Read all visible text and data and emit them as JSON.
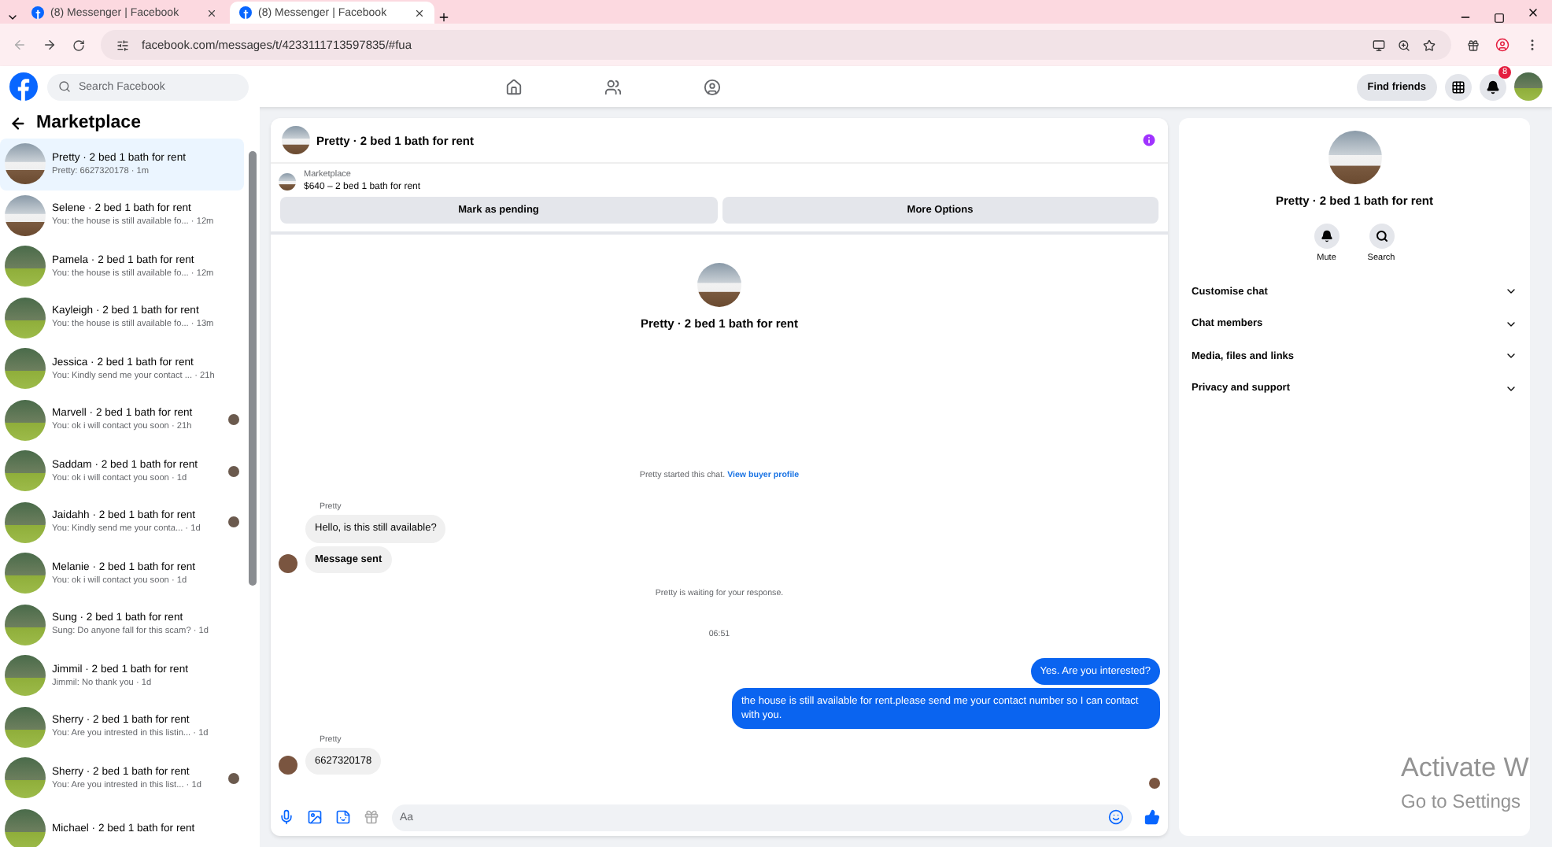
{
  "browser": {
    "tabs": [
      {
        "title": "(8) Messenger | Facebook",
        "selected": false
      },
      {
        "title": "(8) Messenger | Facebook",
        "selected": true
      }
    ],
    "url": "facebook.com/messages/t/4233111713597835/#fua"
  },
  "header": {
    "search_placeholder": "Search Facebook",
    "find_friends": "Find friends",
    "notifications_badge": "8"
  },
  "sidebar": {
    "title": "Marketplace",
    "conversations": [
      {
        "name": "Pretty · 2 bed 1 bath for rent",
        "preview": "Pretty: 6627320178 · 1m",
        "selected": true,
        "seen": false
      },
      {
        "name": "Selene · 2 bed 1 bath for rent",
        "preview": "You: the house is still available fo... · 12m",
        "selected": false,
        "seen": false
      },
      {
        "name": "Pamela · 2 bed 1 bath for rent",
        "preview": "You: the house is still available fo... · 12m",
        "selected": false,
        "seen": false
      },
      {
        "name": "Kayleigh · 2 bed 1 bath for rent",
        "preview": "You: the house is still available fo... · 13m",
        "selected": false,
        "seen": false
      },
      {
        "name": "Jessica · 2 bed 1 bath for rent",
        "preview": "You: Kindly send me your contact ... · 21h",
        "selected": false,
        "seen": false
      },
      {
        "name": "Marvell · 2 bed 1 bath for rent",
        "preview": "You: ok i will contact you soon · 21h",
        "selected": false,
        "seen": true
      },
      {
        "name": "Saddam · 2 bed 1 bath for rent",
        "preview": "You: ok i will contact you soon · 1d",
        "selected": false,
        "seen": true
      },
      {
        "name": "Jaidahh · 2 bed 1 bath for rent",
        "preview": "You: Kindly send me your conta... · 1d",
        "selected": false,
        "seen": true
      },
      {
        "name": "Melanie · 2 bed 1 bath for rent",
        "preview": "You: ok i will contact you soon · 1d",
        "selected": false,
        "seen": false
      },
      {
        "name": "Sung · 2 bed 1 bath for rent",
        "preview": "Sung: Do anyone fall for this scam? · 1d",
        "selected": false,
        "seen": false
      },
      {
        "name": "Jimmil · 2 bed 1 bath for rent",
        "preview": "Jimmil: No thank you · 1d",
        "selected": false,
        "seen": false
      },
      {
        "name": "Sherry · 2 bed 1 bath for rent",
        "preview": "You: Are you intrested in this listin... · 1d",
        "selected": false,
        "seen": false
      },
      {
        "name": "Sherry · 2 bed 1 bath for rent",
        "preview": "You: Are you intrested in this list... · 1d",
        "selected": false,
        "seen": true
      },
      {
        "name": "Michael · 2 bed 1 bath for rent",
        "selected": false,
        "seen": false
      }
    ]
  },
  "chat": {
    "title": "Pretty · 2 bed 1 bath for rent",
    "listing_label": "Marketplace",
    "listing": "$640 – 2 bed 1 bath for rent",
    "actions": [
      "Mark as pending",
      "More Options"
    ],
    "intro_name": "Pretty · 2 bed 1 bath for rent",
    "messages": [
      {
        "kind": "notice",
        "text": "Pretty started this chat.",
        "link": "View buyer profile"
      },
      {
        "kind": "sender",
        "text": "Pretty"
      },
      {
        "kind": "incoming",
        "text": "Hello, is this still available?",
        "avatar": false
      },
      {
        "kind": "incoming_bold",
        "text": "Message sent",
        "avatar": true
      },
      {
        "kind": "notice",
        "text": "Pretty is waiting for your response."
      },
      {
        "kind": "time",
        "text": "06:51"
      },
      {
        "kind": "outgoing",
        "text": "Yes. Are you interested?"
      },
      {
        "kind": "outgoing",
        "text": "the house is still available for rent.please send me your contact number so I can contact with you."
      },
      {
        "kind": "sender",
        "text": "Pretty"
      },
      {
        "kind": "incoming",
        "text": "6627320178",
        "avatar": true
      },
      {
        "kind": "receipt"
      }
    ],
    "composer_placeholder": "Aa"
  },
  "details": {
    "name": "Pretty · 2 bed 1 bath for rent",
    "actions": [
      "Mute",
      "Search"
    ],
    "sections": [
      "Customise chat",
      "Chat members",
      "Media, files and links",
      "Privacy and support"
    ]
  },
  "os_overlay": [
    "Activate W",
    "Go to Settings"
  ]
}
